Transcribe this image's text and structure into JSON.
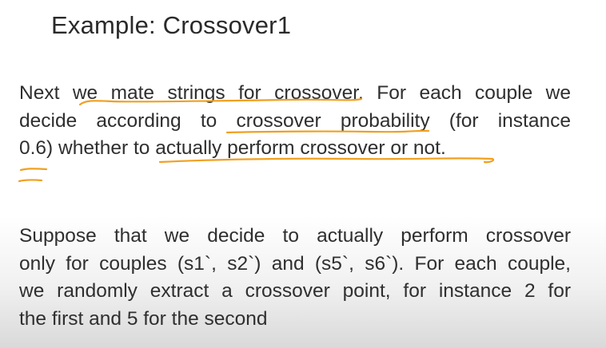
{
  "slide": {
    "title": "Example: Crossover1",
    "paragraph1": {
      "lines": [
        "Next we mate strings for crossover. For each couple we",
        "decide according to crossover probability (for instance",
        "0.6) whether to actually perform crossover or not."
      ]
    },
    "paragraph2": {
      "lines": [
        "Suppose that we decide to actually perform crossover",
        "only for couples (s1`, s2`) and (s5`, s6`). For each couple,",
        "we randomly extract a crossover point, for instance 2 for",
        "the first and 5 for the second"
      ]
    },
    "annotation_color": "#f0a020"
  }
}
